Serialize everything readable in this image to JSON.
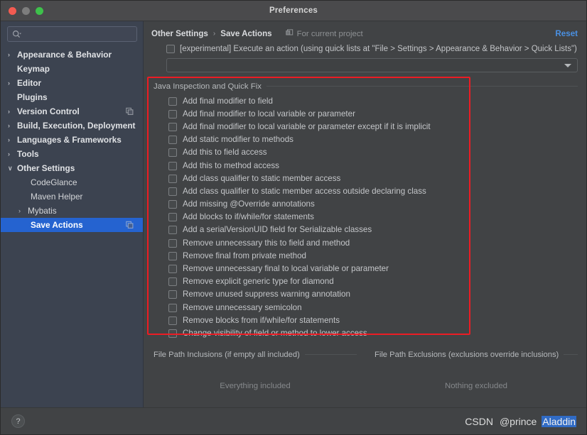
{
  "window": {
    "title": "Preferences",
    "traffic_lights": [
      "close-button",
      "minimize-button",
      "zoom-button"
    ]
  },
  "sidebar": {
    "search": {
      "value": "",
      "placeholder": "",
      "icon": "search-icon"
    },
    "items": [
      {
        "label": "Appearance & Behavior",
        "twisty": "›",
        "level": 0,
        "bold": true,
        "selected": false,
        "icon": ""
      },
      {
        "label": "Keymap",
        "twisty": "",
        "level": 0,
        "bold": true,
        "selected": false,
        "icon": ""
      },
      {
        "label": "Editor",
        "twisty": "›",
        "level": 0,
        "bold": true,
        "selected": false,
        "icon": ""
      },
      {
        "label": "Plugins",
        "twisty": "",
        "level": 0,
        "bold": true,
        "selected": false,
        "icon": ""
      },
      {
        "label": "Version Control",
        "twisty": "›",
        "level": 0,
        "bold": true,
        "selected": false,
        "icon": "copy-icon"
      },
      {
        "label": "Build, Execution, Deployment",
        "twisty": "›",
        "level": 0,
        "bold": true,
        "selected": false,
        "icon": ""
      },
      {
        "label": "Languages & Frameworks",
        "twisty": "›",
        "level": 0,
        "bold": true,
        "selected": false,
        "icon": ""
      },
      {
        "label": "Tools",
        "twisty": "›",
        "level": 0,
        "bold": true,
        "selected": false,
        "icon": ""
      },
      {
        "label": "Other Settings",
        "twisty": "∨",
        "level": 0,
        "bold": true,
        "selected": false,
        "icon": ""
      },
      {
        "label": "CodeGlance",
        "twisty": "",
        "level": 1,
        "bold": false,
        "selected": false,
        "icon": ""
      },
      {
        "label": "Maven Helper",
        "twisty": "",
        "level": 1,
        "bold": false,
        "selected": false,
        "icon": ""
      },
      {
        "label": "Mybatis",
        "twisty": "›",
        "level": 1,
        "bold": false,
        "selected": false,
        "icon": ""
      },
      {
        "label": "Save Actions",
        "twisty": "",
        "level": 1,
        "bold": true,
        "selected": true,
        "icon": "copy-icon"
      }
    ]
  },
  "header": {
    "breadcrumb_root": "Other Settings",
    "breadcrumb_sep": "›",
    "breadcrumb_current": "Save Actions",
    "for_current_project": "For current project",
    "for_current_project_icon": "project-scope-icon",
    "reset_label": "Reset",
    "reset_color": "#4a90e2"
  },
  "experimental": {
    "checkbox_checked": false,
    "label": "[experimental] Execute an action (using quick lists at \"File > Settings > Appearance & Behavior > Quick Lists\")",
    "combo_value": "",
    "combo_arrow_icon": "chevron-down-icon"
  },
  "group": {
    "title": "Java Inspection and Quick Fix",
    "items": [
      {
        "label": "Add final modifier to field",
        "checked": false
      },
      {
        "label": "Add final modifier to local variable or parameter",
        "checked": false
      },
      {
        "label": "Add final modifier to local variable or parameter except if it is implicit",
        "checked": false
      },
      {
        "label": "Add static modifier to methods",
        "checked": false
      },
      {
        "label": "Add this to field access",
        "checked": false
      },
      {
        "label": "Add this to method access",
        "checked": false
      },
      {
        "label": "Add class qualifier to static member access",
        "checked": false
      },
      {
        "label": "Add class qualifier to static member access outside declaring class",
        "checked": false
      },
      {
        "label": "Add missing @Override annotations",
        "checked": false
      },
      {
        "label": "Add blocks to if/while/for statements",
        "checked": false
      },
      {
        "label": "Add a serialVersionUID field for Serializable classes",
        "checked": false
      },
      {
        "label": "Remove unnecessary this to field and method",
        "checked": false
      },
      {
        "label": "Remove final from private method",
        "checked": false
      },
      {
        "label": "Remove unnecessary final to local variable or parameter",
        "checked": false
      },
      {
        "label": "Remove explicit generic type for diamond",
        "checked": false
      },
      {
        "label": "Remove unused suppress warning annotation",
        "checked": false
      },
      {
        "label": "Remove unnecessary semicolon",
        "checked": false
      },
      {
        "label": "Remove blocks from if/while/for statements",
        "checked": false
      },
      {
        "label": "Change visibility of field or method to lower access",
        "checked": false
      }
    ]
  },
  "annotation": {
    "color": "#ec1c24"
  },
  "paths": {
    "inclusions_title": "File Path Inclusions (if empty all included)",
    "inclusions_empty_text": "Everything included",
    "exclusions_title": "File Path Exclusions (exclusions override inclusions)",
    "exclusions_empty_text": "Nothing excluded"
  },
  "footer": {
    "help_label": "?",
    "watermark_1": "CSDN",
    "watermark_2": "@prince",
    "watermark_3": "Aladdin"
  }
}
